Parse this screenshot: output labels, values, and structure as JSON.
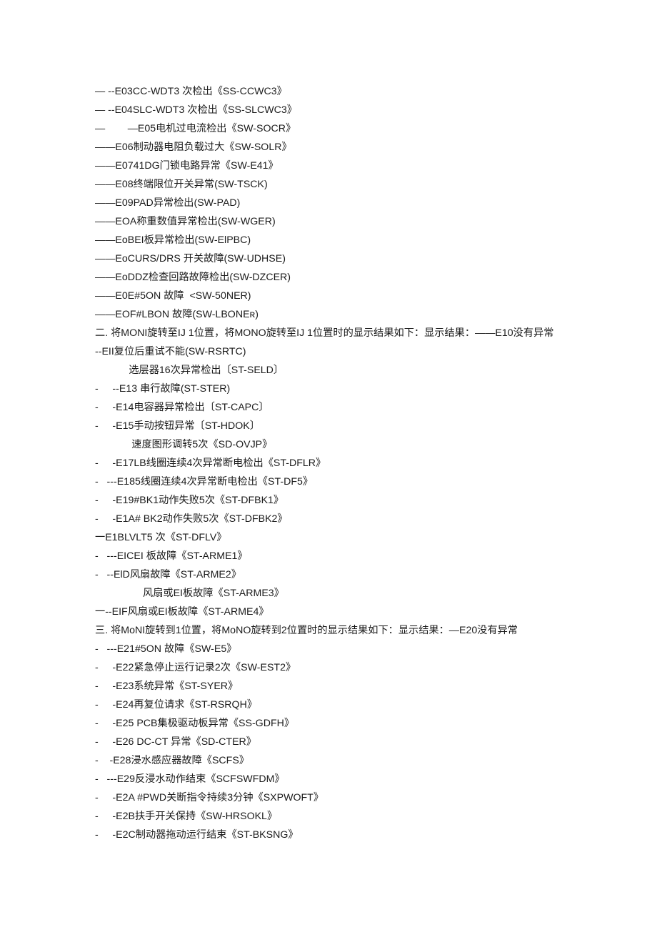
{
  "lines": [
    "— --E03CC-WDT3 次检出《SS-CCWC3》",
    "— --E04SLC-WDT3 次检出《SS-SLCWC3》",
    "—        —E05电机过电流检出《SW-SOCR》",
    "——E06制动器电阻负载过大《SW-SOLR》",
    "——E0741DG门锁电路异常《SW-E41》",
    "——E08终端限位开关异常(SW-TSCK)",
    "——E09PAD异常检出(SW-PAD)",
    "——EOA称重数值异常检出(SW-WGER)",
    "——EoBEI板异常检出(SW-ElPBC)",
    "——EoCURS/DRS 开关故障(SW-UDHSE)",
    "——EoDDZ检查回路故障检出(SW-DZCER)",
    "——E0E#5ON 故障  <SW-50NER)",
    "——EOF#LBON 故障(SW-LBONEʀ)",
    "二. 将MONI旋转至IJ 1位置，将MONO旋转至IJ 1位置时的显示结果如下：显示结果：——E10没有异常",
    "--EII复位后重试不能(SW-RSRTC)",
    "            选层器16次异常检出〔ST-SELD〕",
    "-     --E13 串行故障(ST-STER)",
    "-     -E14电容器异常检出〔ST-CAPC〕",
    "-     -E15手动按钮异常〔ST-HDOK〕",
    "             速度图形调转5次《SD-OVJP》",
    "-     -E17LB线圈连续4次异常断电检出《ST-DFLR》",
    "-   ---E185线圈连续4次异常断电检出《ST-DF5》",
    "-     -E19#BK1动作失败5次《ST-DFBK1》",
    "-     -E1A# BK2动作失败5次《ST-DFBK2》",
    "一E1BLVLT5 次《ST-DFLV》",
    "-   ---EICEI 板故障《ST-ARME1》",
    "-   --ElD风扇故障《ST-ARME2》",
    "                 风扇或EI板故障《ST-ARME3》",
    "一--EIF风扇或EI板故障《ST-ARME4》",
    "三. 将MoNI旋转到1位置，将MoNO旋转到2位置时的显示结果如下：显示结果：—E20没有异常",
    "-   ---E21#5ON 故障《SW-E5》",
    "-     -E22紧急停止运行记录2次《SW-EST2》",
    "-     -E23系统异常《ST-SYER》",
    "-     -E24再复位请求《ST-RSRQH》",
    "-     -E25 PCB集极驱动板异常《SS-GDFH》",
    "-     -E26 DC-CT 异常《SD-CTER》",
    "-    -E28浸水感应器故障《SCFS》",
    "-   ---E29反浸水动作结束《SCFSWFDM》",
    "-     -E2A #PWD关断指令持续3分钟《SXPWOFT》",
    "-     -E2B扶手开关保持《SW-HRSOKL》",
    "-     -E2C制动器拖动运行结束《ST-BKSNG》"
  ]
}
